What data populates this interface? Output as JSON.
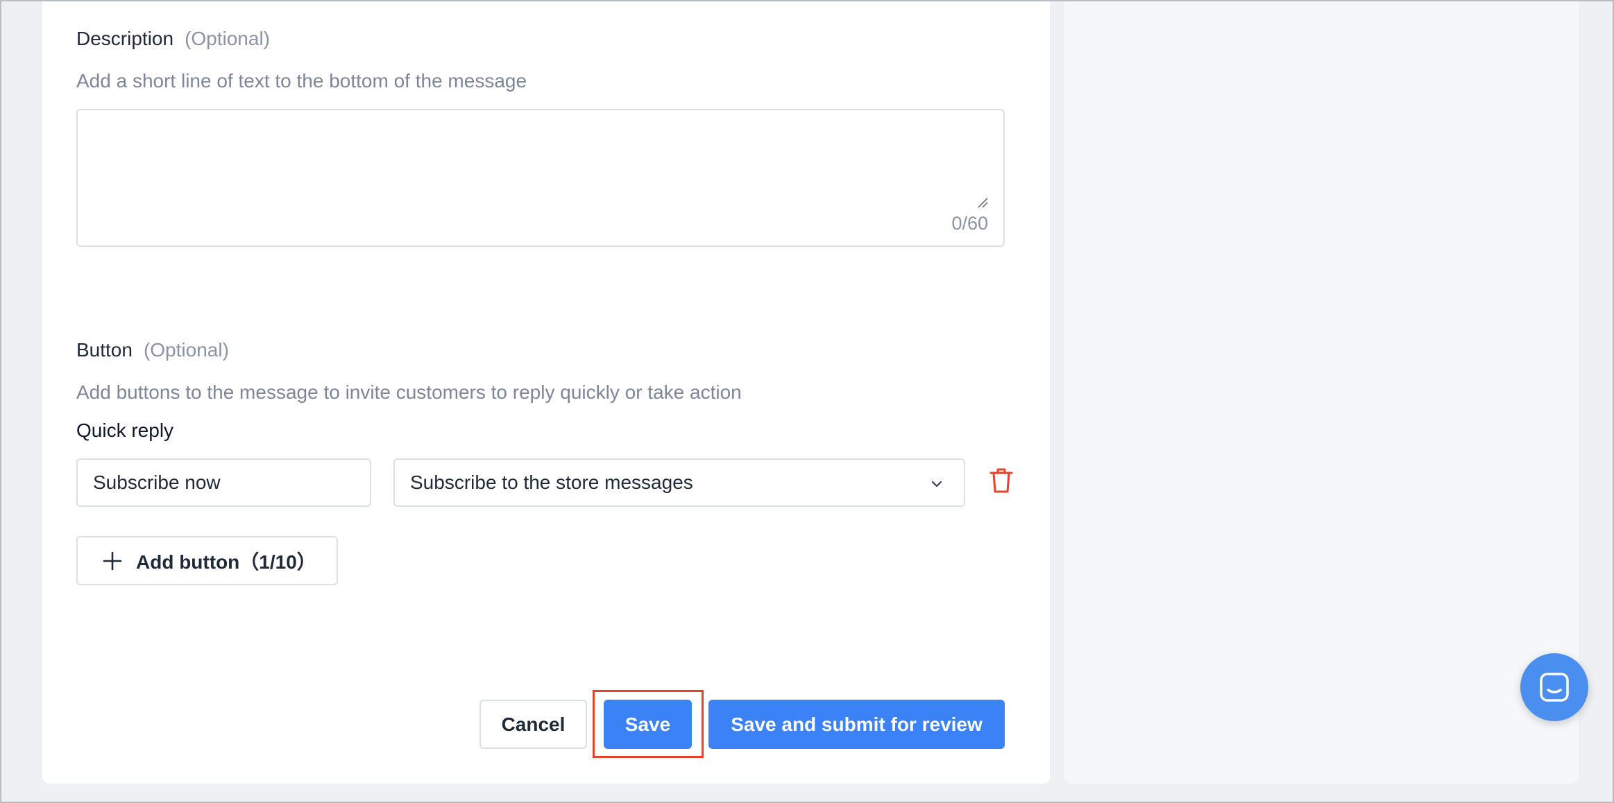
{
  "description": {
    "title": "Description",
    "optional": "(Optional)",
    "hint": "Add a short line of text to the bottom of the message",
    "value": "",
    "counter": "0/60"
  },
  "button_section": {
    "title": "Button",
    "optional": "(Optional)",
    "hint": "Add buttons to the message to invite customers to reply quickly or take action",
    "quick_reply_label": "Quick reply",
    "reply_text_value": "Subscribe now",
    "reply_action_value": "Subscribe to the store messages",
    "add_button_label": "Add button（1/10）"
  },
  "footer": {
    "cancel_label": "Cancel",
    "save_label": "Save",
    "submit_label": "Save and submit for review"
  },
  "icons": {
    "delete": "trash-icon",
    "dropdown": "chevron-down-icon",
    "add": "plus-icon",
    "chat": "chat-icon"
  },
  "colors": {
    "primary": "#3b82f6",
    "danger": "#e0442c",
    "highlight": "#e0442c"
  }
}
